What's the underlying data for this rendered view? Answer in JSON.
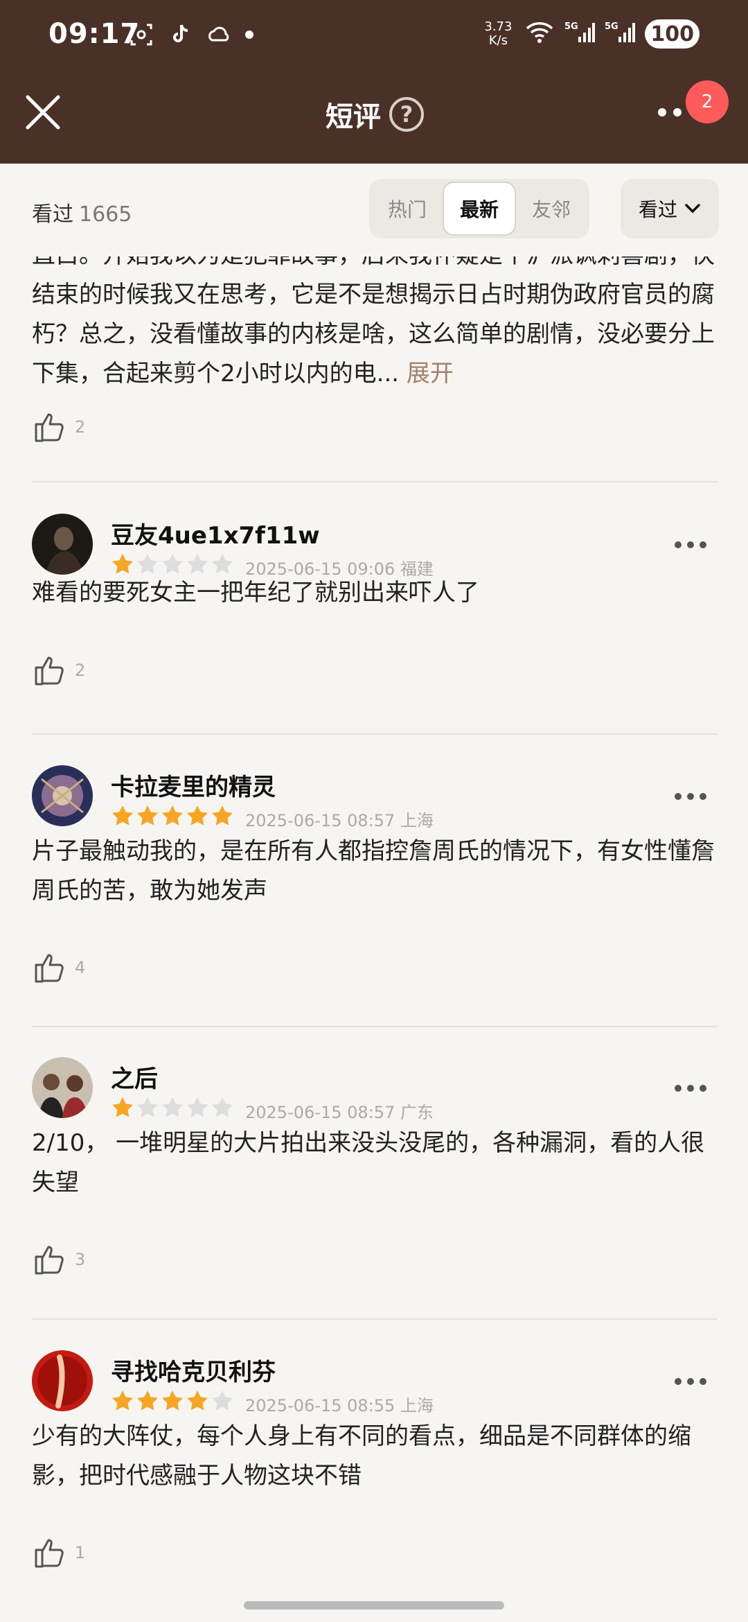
{
  "status_bar": {
    "time": "09:17",
    "net_speed_value": "3.73",
    "net_speed_unit": "K/s",
    "battery": "100"
  },
  "nav": {
    "title": "短评",
    "help": "?",
    "badge_count": "2"
  },
  "filter": {
    "count_label": "看过",
    "count_value": "1665",
    "tabs": [
      "热门",
      "最新",
      "友邻"
    ],
    "active_tab": "最新",
    "dropdown_label": "看过"
  },
  "partial_review": {
    "text": "直白。开始我以为是犯罪故事，后来我怀疑是个沪派讽刺喜剧，快结束的时候我又在思考，它是不是想揭示日占时期伪政府官员的腐朽？总之，没看懂故事的内核是啥，这么简单的剧情，没必要分上下集，合起来剪个2小时以内的电...",
    "expand_label": "展开",
    "likes": "2"
  },
  "reviews": [
    {
      "username": "豆友4ue1x7f11w",
      "rating": 1,
      "datetime": "2025-06-15 09:06",
      "location": "福建",
      "text": "难看的要死女主一把年纪了就别出来吓人了",
      "likes": "2"
    },
    {
      "username": "卡拉麦里的精灵",
      "rating": 5,
      "datetime": "2025-06-15 08:57",
      "location": "上海",
      "text": "片子最触动我的，是在所有人都指控詹周氏的情况下，有女性懂詹周氏的苦，敢为她发声",
      "likes": "4"
    },
    {
      "username": "之后",
      "rating": 1,
      "datetime": "2025-06-15 08:57",
      "location": "广东",
      "text": "2/10， 一堆明星的大片拍出来没头没尾的，各种漏洞，看的人很失望",
      "likes": "3"
    },
    {
      "username": "寻找哈克贝利芬",
      "rating": 4,
      "datetime": "2025-06-15 08:55",
      "location": "上海",
      "text": "少有的大阵仗，每个人身上有不同的看点，细品是不同群体的缩影，把时代感融于人物这块不错",
      "likes": "1"
    }
  ],
  "colors": {
    "topbar": "#4a3128",
    "star_on": "#f6a623",
    "star_off": "#dddddd",
    "badge": "#ff5b5b",
    "expand": "#a3806a"
  }
}
